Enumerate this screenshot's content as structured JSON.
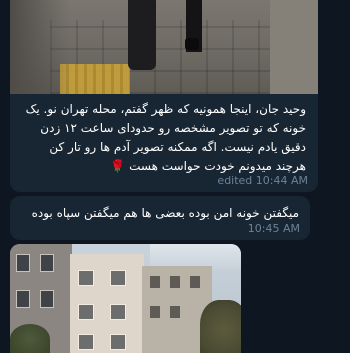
{
  "messages": [
    {
      "type": "photo-caption",
      "text": "وحید جان، اینجا همونیه که ظهر گفتم، محله تهران نو. یک خونه که تو تصویر مشخصه رو حدودای ساعت ۱۲ زدن دقیق یادم نیست. اگه ممکنه تصویر آدم ها رو تار کن هرچند میدونم خودت حواست هست 🌹",
      "meta": "edited 10:44 AM"
    },
    {
      "type": "text",
      "text": "میگفتن خونه امن بوده بعضی ها هم میگفتن سپاه بوده",
      "meta": "10:45 AM"
    },
    {
      "type": "photo",
      "meta": ""
    }
  ],
  "colors": {
    "background": "#0e1621",
    "bubble": "#182533",
    "meta_text": "#6b8399",
    "text": "#ffffff"
  }
}
